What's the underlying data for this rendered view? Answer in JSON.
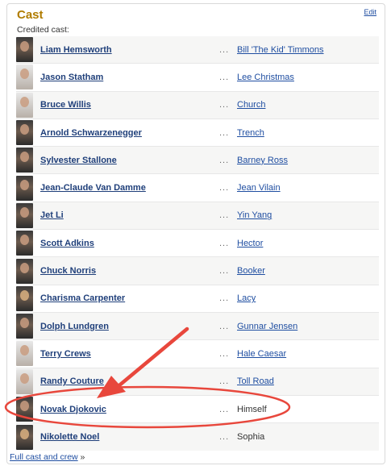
{
  "section": {
    "title": "Cast",
    "edit_label": "Edit",
    "credited_label": "Credited cast:",
    "footer_link": "Full cast and crew",
    "footer_suffix": "»"
  },
  "cast": [
    {
      "actor": "Liam Hemsworth",
      "dots": "...",
      "role": "Bill 'The Kid' Timmons",
      "role_linked": true
    },
    {
      "actor": "Jason Statham",
      "dots": "...",
      "role": "Lee Christmas",
      "role_linked": true
    },
    {
      "actor": "Bruce Willis",
      "dots": "...",
      "role": "Church",
      "role_linked": true
    },
    {
      "actor": "Arnold Schwarzenegger",
      "dots": "...",
      "role": "Trench",
      "role_linked": true
    },
    {
      "actor": "Sylvester Stallone",
      "dots": "...",
      "role": "Barney Ross",
      "role_linked": true
    },
    {
      "actor": "Jean-Claude Van Damme",
      "dots": "...",
      "role": "Jean Vilain",
      "role_linked": true
    },
    {
      "actor": "Jet Li",
      "dots": "...",
      "role": "Yin Yang",
      "role_linked": true
    },
    {
      "actor": "Scott Adkins",
      "dots": "...",
      "role": "Hector",
      "role_linked": true
    },
    {
      "actor": "Chuck Norris",
      "dots": "...",
      "role": "Booker",
      "role_linked": true
    },
    {
      "actor": "Charisma Carpenter",
      "dots": "...",
      "role": "Lacy",
      "role_linked": true
    },
    {
      "actor": "Dolph Lundgren",
      "dots": "...",
      "role": "Gunnar Jensen",
      "role_linked": true
    },
    {
      "actor": "Terry Crews",
      "dots": "...",
      "role": "Hale Caesar",
      "role_linked": true
    },
    {
      "actor": "Randy Couture",
      "dots": "...",
      "role": "Toll Road",
      "role_linked": true
    },
    {
      "actor": "Novak Djokovic",
      "dots": "...",
      "role": "Himself",
      "role_linked": false
    },
    {
      "actor": "Nikolette Noel",
      "dots": "...",
      "role": "Sophia",
      "role_linked": false
    }
  ],
  "annotation": {
    "color": "#e8473c"
  }
}
